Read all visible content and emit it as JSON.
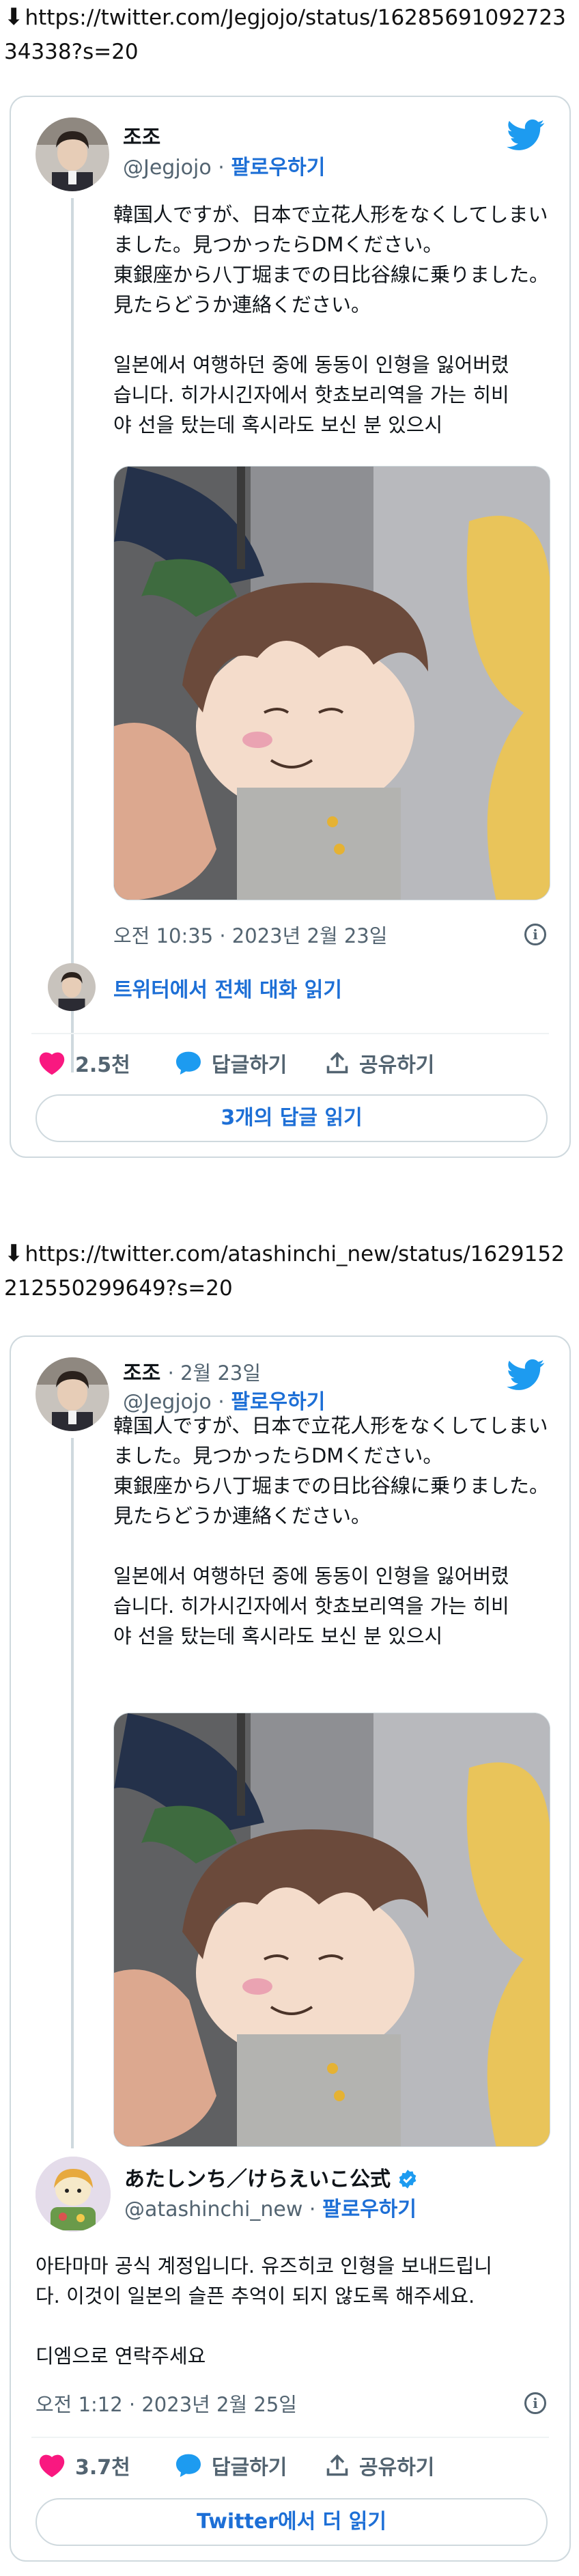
{
  "tweet1": {
    "url": "https://twitter.com/Jegjojo/status/1628569109272334338?s=20",
    "name": "조조",
    "handle": "@Jegjojo",
    "follow": "팔로우하기",
    "sep": "·",
    "text_jp": [
      "韓国人ですが、日本で立花人形をなくしてしまい",
      "ました。見つかったらDMください。",
      "東銀座から八丁堀までの日比谷線に乗りました。",
      "見たらどうか連絡ください。"
    ],
    "text_kr": [
      "일본에서 여행하던 중에 동동이 인형을 잃어버렸",
      "습니다. 히가시긴자에서 핫쵸보리역을 가는 히비",
      "야 선을 탔는데 혹시라도 보신 분 있으시"
    ],
    "timestamp": "오전 10:35 · 2023년 2월 23일",
    "read_conversation": "트위터에서 전체 대화 읽기",
    "likes": "2.5천",
    "reply_label": "답글하기",
    "share_label": "공유하기",
    "read_replies": "3개의 답글 읽기"
  },
  "tweet2": {
    "url": "https://twitter.com/atashinchi_new/status/1629152212550299649?s=20",
    "parent": {
      "name": "조조",
      "date": "2월 23일",
      "handle": "@Jegjojo",
      "follow": "팔로우하기",
      "text_jp": [
        "韓国人ですが、日本で立花人形をなくしてしまい",
        "ました。見つかったらDMください。",
        "東銀座から八丁堀までの日比谷線に乗りました。",
        "見たらどうか連絡ください。"
      ],
      "text_kr": [
        "일본에서 여행하던 중에 동동이 인형을 잃어버렸",
        "습니다. 히가시긴자에서 핫쵸보리역을 가는 히비",
        "야 선을 탔는데 혹시라도 보신 분 있으시"
      ]
    },
    "reply": {
      "name": "あたしンち／けらえいこ公式",
      "handle": "@atashinchi_new",
      "follow": "팔로우하기",
      "text": [
        "아타마마 공식 계정입니다. 유즈히코 인형을 보내드립니",
        "다. 이것이 일본의 슬픈 추억이 되지 않도록 해주세요."
      ],
      "text2": "디엠으로 연락주세요",
      "timestamp": "오전 1:12 · 2023년 2월 25일"
    },
    "likes": "3.7천",
    "reply_label": "답글하기",
    "share_label": "공유하기",
    "read_more": "Twitter에서 더 읽기"
  },
  "icons": [
    "down-arrow-icon",
    "twitter-bird-icon",
    "verified-badge-icon",
    "heart-icon",
    "reply-bubble-icon",
    "share-icon",
    "info-icon"
  ],
  "colors": {
    "accent": "#1d6fd6",
    "heart": "#f91880",
    "twitter": "#1d9bf0",
    "border": "#cfd9de",
    "muted": "#536471"
  }
}
